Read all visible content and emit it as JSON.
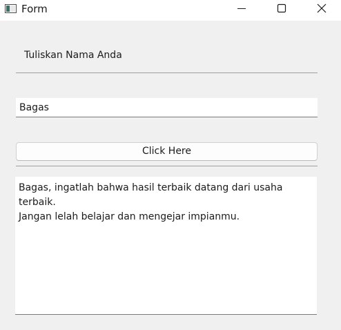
{
  "window": {
    "title": "Form"
  },
  "form": {
    "prompt_label": "Tuliskan Nama Anda",
    "name_input_value": "Bagas",
    "button_label": "Click Here",
    "output_text": "Bagas, ingatlah bahwa hasil terbaik datang dari usaha terbaik.\nJangan lelah belajar dan mengejar impianmu."
  },
  "icons": {
    "app": "app-window-icon",
    "minimize": "minimize-icon",
    "maximize": "maximize-icon",
    "close": "close-icon"
  }
}
